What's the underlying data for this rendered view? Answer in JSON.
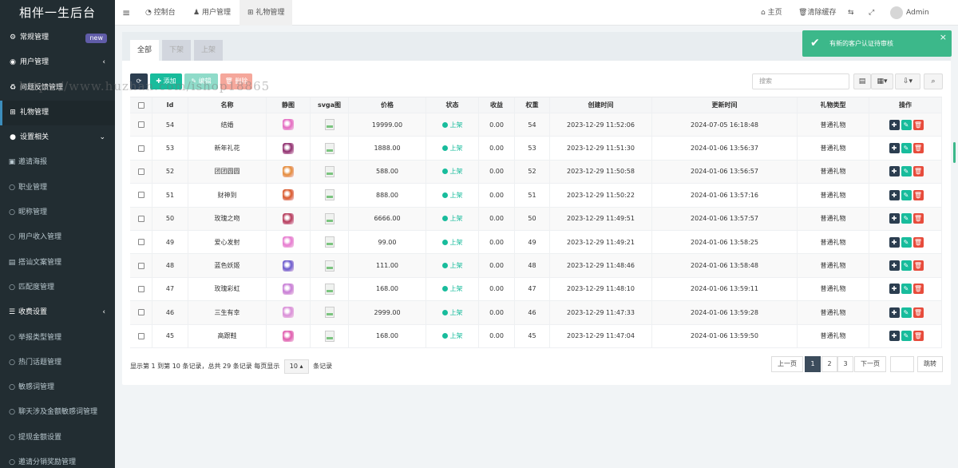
{
  "app": {
    "title": "相伴一生后台"
  },
  "sidebar": {
    "items": [
      {
        "label": "常规管理",
        "icon": "gears-icon",
        "badge": "new"
      },
      {
        "label": "用户管理",
        "icon": "user-circle-icon",
        "arrow": "‹"
      },
      {
        "label": "问题反馈管理",
        "icon": "recycle-icon"
      },
      {
        "label": "礼物管理",
        "icon": "gift-icon"
      },
      {
        "label": "设置相关",
        "icon": "apple-icon",
        "arrow": "⌄"
      },
      {
        "label": "邀请海报",
        "icon": "picture-icon"
      },
      {
        "label": "职业管理",
        "icon": "circle-icon"
      },
      {
        "label": "昵称管理",
        "icon": "circle-icon"
      },
      {
        "label": "用户收入管理",
        "icon": "circle-icon"
      },
      {
        "label": "搭讪文案管理",
        "icon": "list-icon"
      },
      {
        "label": "匹配度管理",
        "icon": "circle-icon"
      },
      {
        "label": "收费设置",
        "icon": "list-lines-icon",
        "arrow": "‹"
      },
      {
        "label": "举报类型管理",
        "icon": "circle-icon"
      },
      {
        "label": "热门话题管理",
        "icon": "circle-icon"
      },
      {
        "label": "敏感词管理",
        "icon": "circle-icon"
      },
      {
        "label": "聊天涉及金额敏感词管理",
        "icon": "circle-icon"
      },
      {
        "label": "提现金额设置",
        "icon": "circle-icon"
      },
      {
        "label": "邀请分销奖励管理",
        "icon": "circle-icon"
      }
    ]
  },
  "header": {
    "menu_icon": "≡",
    "tabs": [
      {
        "label": "控制台"
      },
      {
        "label": "用户管理"
      },
      {
        "label": "礼物管理"
      }
    ],
    "right": {
      "home": "主页",
      "clear_cache": "清除缓存",
      "user": "Admin"
    }
  },
  "watermark": "https://www.huzhan.com/ishop18865",
  "notice": {
    "text": "有新的客户认证待审核",
    "close": "×"
  },
  "filter_tabs": [
    {
      "label": "全部"
    },
    {
      "label": "下架"
    },
    {
      "label": "上架"
    }
  ],
  "toolbar": {
    "refresh": "⟳",
    "add": "添加",
    "edit": "编辑",
    "delete": "删除",
    "search_placeholder": "搜索"
  },
  "table": {
    "headers": [
      "Id",
      "名称",
      "静图",
      "svga图",
      "价格",
      "状态",
      "收益",
      "权重",
      "创建时间",
      "更新时间",
      "礼物类型",
      "操作"
    ],
    "rows": [
      {
        "id": "54",
        "name": "结婚",
        "price": "19999.00",
        "status": "上架",
        "income": "0.00",
        "weight": "54",
        "created": "2023-12-29 11:52:06",
        "updated": "2024-07-05 16:18:48",
        "type": "普通礼物",
        "img_color": "#e46bc1"
      },
      {
        "id": "53",
        "name": "新年礼花",
        "price": "1888.00",
        "status": "上架",
        "income": "0.00",
        "weight": "53",
        "created": "2023-12-29 11:51:30",
        "updated": "2024-01-06 13:56:37",
        "type": "普通礼物",
        "img_color": "#8e2d6d"
      },
      {
        "id": "52",
        "name": "团团圆圆",
        "price": "588.00",
        "status": "上架",
        "income": "0.00",
        "weight": "52",
        "created": "2023-12-29 11:50:58",
        "updated": "2024-01-06 13:56:57",
        "type": "普通礼物",
        "img_color": "#e58b3a"
      },
      {
        "id": "51",
        "name": "财神到",
        "price": "888.00",
        "status": "上架",
        "income": "0.00",
        "weight": "51",
        "created": "2023-12-29 11:50:22",
        "updated": "2024-01-06 13:57:16",
        "type": "普通礼物",
        "img_color": "#d9582a"
      },
      {
        "id": "50",
        "name": "玫瑰之吻",
        "price": "6666.00",
        "status": "上架",
        "income": "0.00",
        "weight": "50",
        "created": "2023-12-29 11:49:51",
        "updated": "2024-01-06 13:57:57",
        "type": "普通礼物",
        "img_color": "#b53a5a"
      },
      {
        "id": "49",
        "name": "爱心发射",
        "price": "99.00",
        "status": "上架",
        "income": "0.00",
        "weight": "49",
        "created": "2023-12-29 11:49:21",
        "updated": "2024-01-06 13:58:25",
        "type": "普通礼物",
        "img_color": "#e77bd0"
      },
      {
        "id": "48",
        "name": "蓝色妖姬",
        "price": "111.00",
        "status": "上架",
        "income": "0.00",
        "weight": "48",
        "created": "2023-12-29 11:48:46",
        "updated": "2024-01-06 13:58:48",
        "type": "普通礼物",
        "img_color": "#6a5acd"
      },
      {
        "id": "47",
        "name": "玫瑰彩虹",
        "price": "168.00",
        "status": "上架",
        "income": "0.00",
        "weight": "47",
        "created": "2023-12-29 11:48:10",
        "updated": "2024-01-06 13:59:11",
        "type": "普通礼物",
        "img_color": "#c77dd6"
      },
      {
        "id": "46",
        "name": "三生有幸",
        "price": "2999.00",
        "status": "上架",
        "income": "0.00",
        "weight": "46",
        "created": "2023-12-29 11:47:33",
        "updated": "2024-01-06 13:59:28",
        "type": "普通礼物",
        "img_color": "#d98fd8"
      },
      {
        "id": "45",
        "name": "高跟鞋",
        "price": "168.00",
        "status": "上架",
        "income": "0.00",
        "weight": "45",
        "created": "2023-12-29 11:47:04",
        "updated": "2024-01-06 13:59:50",
        "type": "普通礼物",
        "img_color": "#e05cae"
      }
    ]
  },
  "pagination": {
    "summary_prefix": "显示第 1 到第 10 条记录，总共 29 条记录 每页显示",
    "page_size": "10",
    "summary_suffix": "条记录",
    "prev": "上一页",
    "pages": [
      "1",
      "2",
      "3"
    ],
    "next": "下一页",
    "jump": "跳转"
  }
}
